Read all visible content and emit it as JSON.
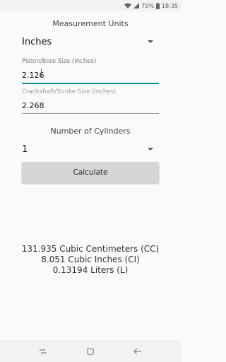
{
  "status_bar": {
    "battery_percent": "75%",
    "time": "18:35",
    "icons": [
      "wifi-icon",
      "signal-icon",
      "battery-icon"
    ]
  },
  "units": {
    "label": "Measurement Units",
    "selected": "Inches"
  },
  "bore": {
    "hint": "Piston/Bore Size (Inches)",
    "value": "2.126"
  },
  "stroke": {
    "hint": "Crankshaft/Stroke Size (Inches)",
    "value": "2.268"
  },
  "cylinders": {
    "label": "Number of Cylinders",
    "selected": "1"
  },
  "calculate_label": "Calculate",
  "results": {
    "cc": "131.935 Cubic Centimeters (CC)",
    "ci": "8.051 Cubic Inches (CI)",
    "liters": "0.13194 Liters (L)"
  },
  "colors": {
    "accent": "#009688",
    "button": "#d6d6d6",
    "background": "#fafafa"
  },
  "nav_icons": [
    "recent-apps-icon",
    "home-icon",
    "back-icon"
  ]
}
